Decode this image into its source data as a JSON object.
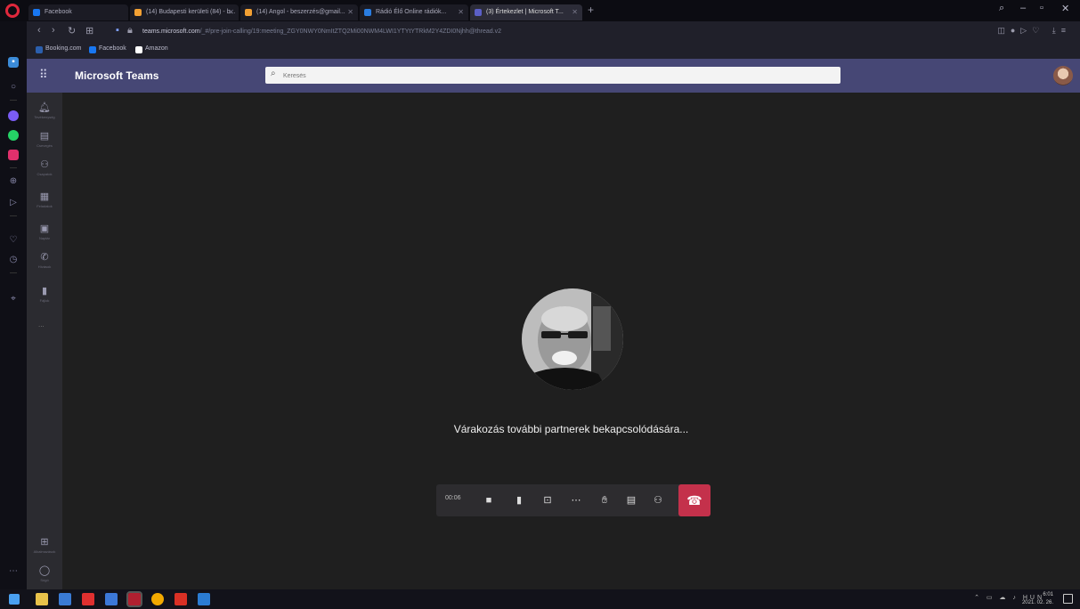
{
  "browser": {
    "tabs": [
      {
        "title": "Facebook",
        "color": "#1877f2"
      },
      {
        "title": "(14) Budapesti kerületi (84) - b...",
        "color": "#f2a033"
      },
      {
        "title": "(14) Angol - beszerzés@gmail...",
        "color": "#f2a033"
      },
      {
        "title": "Rádió Élő Online rádiók...",
        "color": "#2a7de1"
      },
      {
        "title": "(3) Értekezlet | Microsoft T...",
        "color": "#5b5fc7"
      }
    ],
    "new_tab": "+",
    "url_domain": "teams.microsoft.com",
    "url_rest": "/_#/pre-join-calling/19:meeting_ZGY0NWY0NmItZTQ2Mi00NWM4LWI1YTYtYTRkM2Y4ZDI0Njhh@thread.v2",
    "bookmarks": [
      {
        "label": "Booking.com",
        "color": "#2b5fad"
      },
      {
        "label": "Facebook",
        "color": "#1877f2"
      },
      {
        "label": "Amazon",
        "color": "#ffffff"
      }
    ]
  },
  "opera_sidebar": {
    "icons": [
      "home-icon",
      "messenger-icon",
      "whatsapp-icon",
      "instagram-icon",
      "vk-icon",
      "flow-icon",
      "heart-icon",
      "history-icon",
      "location-icon"
    ]
  },
  "teams": {
    "app_title": "Microsoft Teams",
    "search_placeholder": "Keresés",
    "rail": [
      "Tevékenység",
      "Csevegés",
      "Csapatok",
      "Feladatok",
      "Naptár",
      "Hívások",
      "Fájlok"
    ],
    "rail_more": "...",
    "rail_bottom": [
      "Alkalmazások",
      "Súgó"
    ],
    "waiting_text": "Várakozás további partnerek bekapcsolódására...",
    "call_timer": "00:06",
    "controls": [
      "camera-icon",
      "microphone-icon",
      "share-screen-icon",
      "more-icon",
      "raise-hand-icon",
      "chat-icon",
      "participants-icon"
    ],
    "hangup_icon": "phone-hangup-icon",
    "colors": {
      "header": "#464775",
      "hangup": "#c4314b",
      "stage": "#1f1f1f"
    }
  },
  "taskbar": {
    "time": "6:01",
    "date": "2021. 02. 26.",
    "lang": "HUN"
  }
}
